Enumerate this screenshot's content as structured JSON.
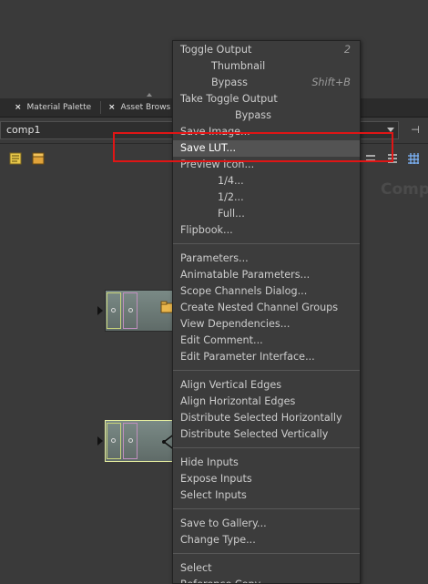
{
  "tabs": [
    {
      "label": "Material Palette",
      "close": "×"
    },
    {
      "label": "Asset Brows",
      "close": "×"
    }
  ],
  "path": {
    "value": "comp1"
  },
  "network": {
    "watermark": "Comp"
  },
  "menu": {
    "items": [
      {
        "label": "Toggle Output",
        "shortcut": "2"
      },
      {
        "label": "Thumbnail",
        "shortcut": ""
      },
      {
        "label": "Bypass",
        "shortcut": "Shift+B"
      },
      {
        "label": "Take Toggle Output",
        "shortcut": ""
      },
      {
        "label": "Bypass",
        "shortcut": ""
      },
      {
        "label": "Save Image...",
        "shortcut": ""
      },
      {
        "label": "Save LUT...",
        "shortcut": ""
      },
      {
        "label": "Preview Icon...",
        "shortcut": ""
      },
      {
        "label": "1/4...",
        "shortcut": ""
      },
      {
        "label": "1/2...",
        "shortcut": ""
      },
      {
        "label": "Full...",
        "shortcut": ""
      },
      {
        "label": "Flipbook...",
        "shortcut": ""
      },
      {
        "label": "Parameters...",
        "shortcut": ""
      },
      {
        "label": "Animatable Parameters...",
        "shortcut": ""
      },
      {
        "label": "Scope Channels Dialog...",
        "shortcut": ""
      },
      {
        "label": "Create Nested Channel Groups",
        "shortcut": ""
      },
      {
        "label": "View Dependencies...",
        "shortcut": ""
      },
      {
        "label": "Edit Comment...",
        "shortcut": ""
      },
      {
        "label": "Edit Parameter Interface...",
        "shortcut": ""
      },
      {
        "label": "Align Vertical Edges",
        "shortcut": ""
      },
      {
        "label": "Align Horizontal Edges",
        "shortcut": ""
      },
      {
        "label": "Distribute Selected Horizontally",
        "shortcut": ""
      },
      {
        "label": "Distribute Selected Vertically",
        "shortcut": ""
      },
      {
        "label": "Hide Inputs",
        "shortcut": ""
      },
      {
        "label": "Expose Inputs",
        "shortcut": ""
      },
      {
        "label": "Select Inputs",
        "shortcut": ""
      },
      {
        "label": "Save to Gallery...",
        "shortcut": ""
      },
      {
        "label": "Change Type...",
        "shortcut": ""
      },
      {
        "label": "Select",
        "shortcut": ""
      },
      {
        "label": "Reference Copy",
        "shortcut": ""
      }
    ]
  }
}
